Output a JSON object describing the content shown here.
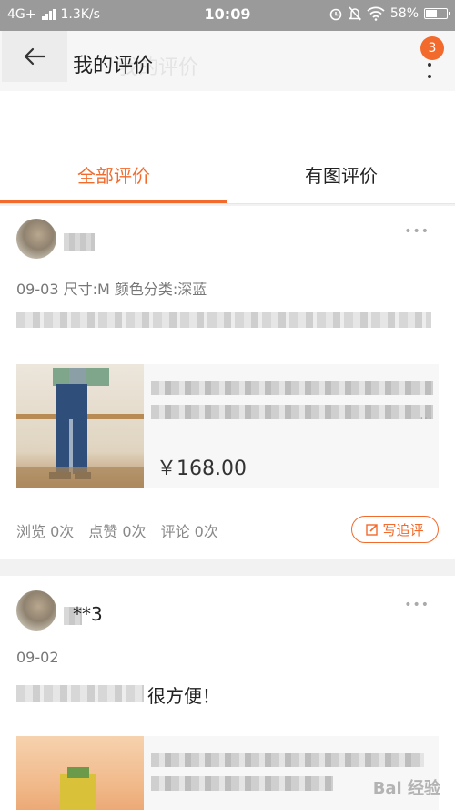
{
  "status_bar": {
    "network": "4G+",
    "speed": "1.3K/s",
    "time": "10:09",
    "battery": "58%",
    "battery_level": 0.58
  },
  "header": {
    "title": "我的评价",
    "badge_count": "3"
  },
  "tabs": [
    {
      "label": "全部评价",
      "active": true
    },
    {
      "label": "有图评价",
      "active": false
    }
  ],
  "reviews": [
    {
      "user_name": "",
      "meta": "09-03  尺寸:M  颜色分类:深蓝",
      "text": "",
      "product": {
        "price": "￥168.00"
      },
      "stats": {
        "views": "浏览 0次",
        "likes": "点赞 0次",
        "comments": "评论 0次"
      },
      "follow_label": "写追评"
    },
    {
      "user_name": "**3",
      "meta": "09-02",
      "text": "很方便！"
    }
  ],
  "watermark": "Bai 经验",
  "colors": {
    "accent": "#f26a2c"
  }
}
